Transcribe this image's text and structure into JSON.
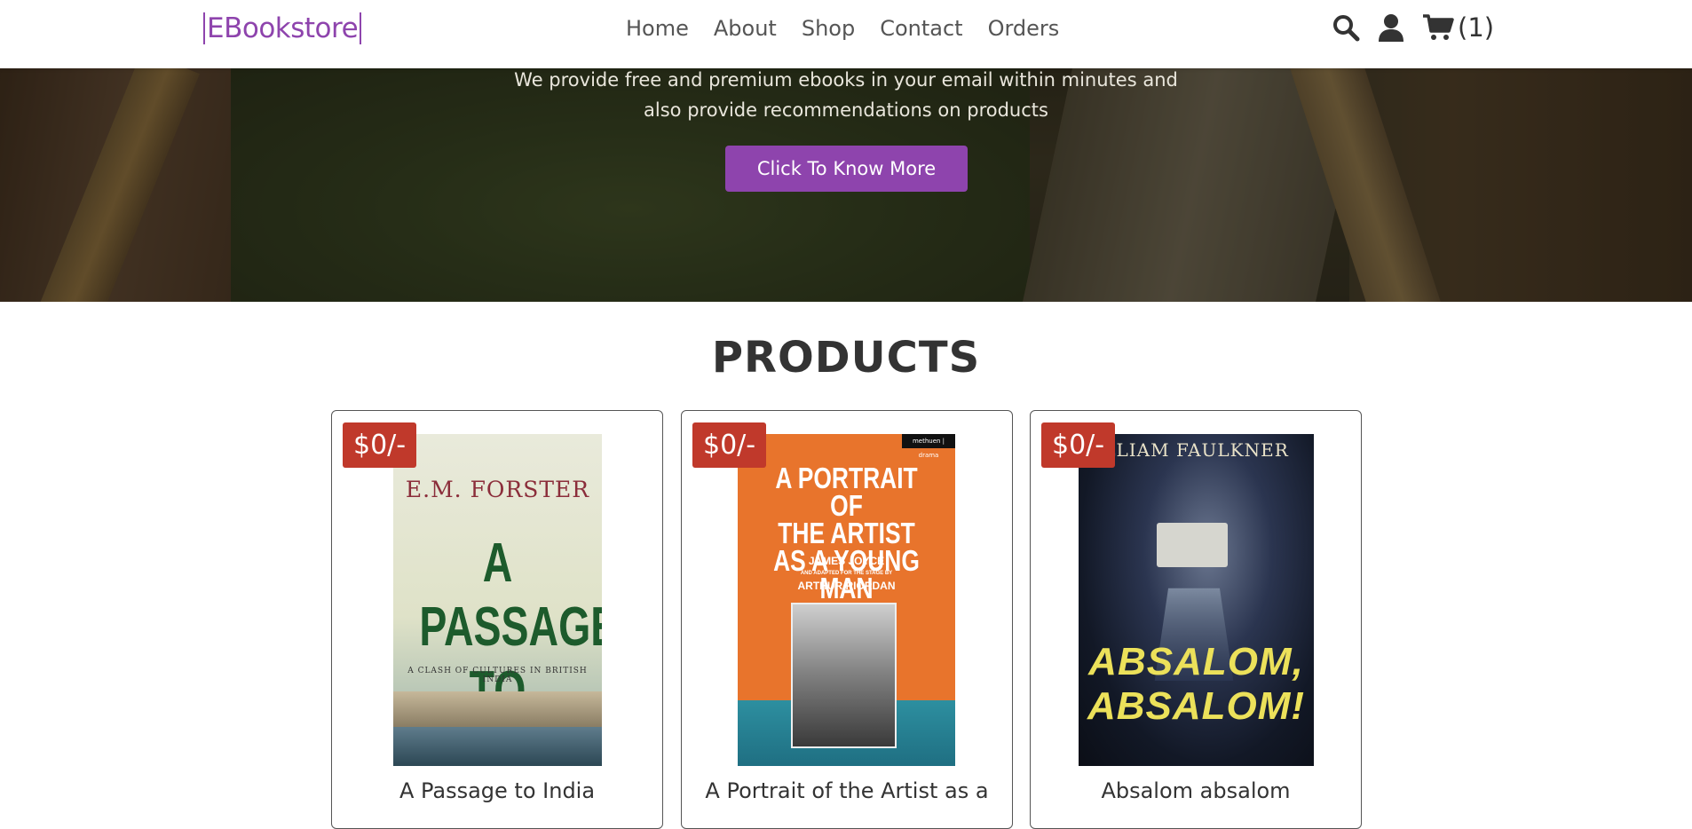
{
  "header": {
    "logo": "EBookstore",
    "nav": [
      "Home",
      "About",
      "Shop",
      "Contact",
      "Orders"
    ],
    "cart_count": "(1)",
    "icons": [
      "search-icon",
      "user-icon",
      "cart-icon"
    ],
    "brand_color": "#8e44ad"
  },
  "hero": {
    "line1": "We provide free and premium ebooks in your email within minutes and",
    "line2": "also provide recommendations on products",
    "button_label": "Click To Know More"
  },
  "products": {
    "title": "PRODUCTS",
    "price_color": "#c0392b",
    "items": [
      {
        "price": "$0/-",
        "title": "A Passage to India",
        "cover": {
          "author": "E.M. FORSTER",
          "title_line1": "A PASSAGE",
          "title_line2": "TO INDIA",
          "subtitle": "A CLASH OF CULTURES IN BRITISH INDIA"
        }
      },
      {
        "price": "$0/-",
        "title": "A Portrait of the Artist as a",
        "cover": {
          "publisher": "methuen | drama",
          "title_line1": "A PORTRAIT OF",
          "title_line2": "THE ARTIST",
          "title_line3": "AS A YOUNG MAN",
          "author": "JAMES JOYCE",
          "adapted": "AND ADAPTED FOR THE STAGE BY",
          "adapter": "ARTHUR RIORDAN"
        }
      },
      {
        "price": "$0/-",
        "title": "Absalom absalom",
        "cover": {
          "author": "LLIAM FAULKNER",
          "title_line1": "ABSALOM,",
          "title_line2": "ABSALOM!"
        }
      }
    ]
  }
}
